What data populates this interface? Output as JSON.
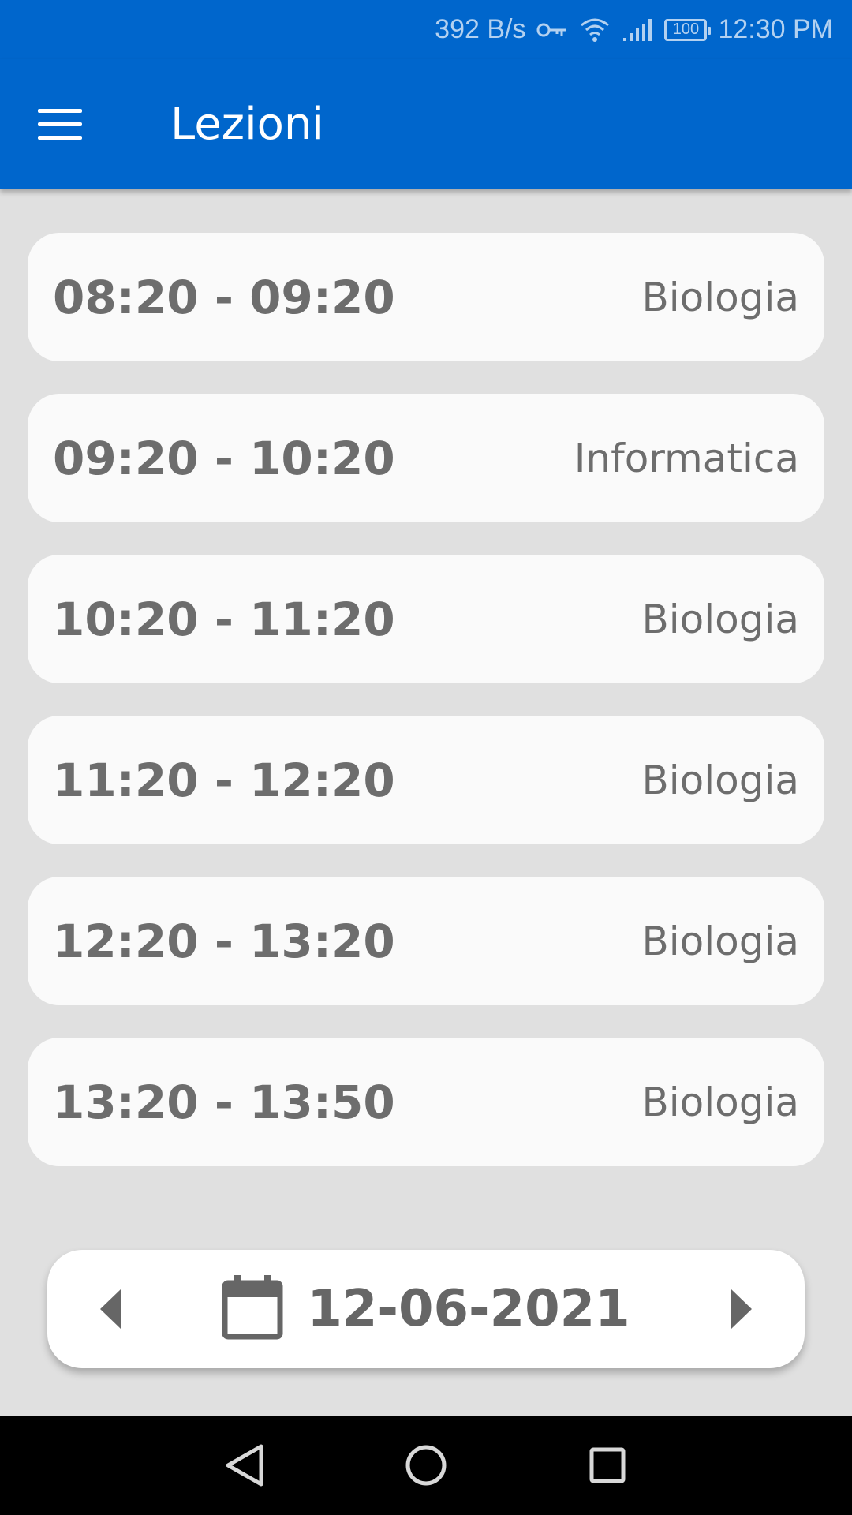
{
  "status_bar": {
    "net_speed": "392 B/s",
    "battery": "100",
    "time": "12:30 PM",
    "icons": [
      "key-icon",
      "wifi-icon",
      "signal-icon",
      "battery-icon"
    ]
  },
  "app_bar": {
    "title": "Lezioni",
    "menu_icon": "hamburger-menu-icon",
    "background": "#0066cc"
  },
  "lessons": [
    {
      "time": "08:20 - 09:20",
      "subject": "Biologia"
    },
    {
      "time": "09:20 - 10:20",
      "subject": "Informatica"
    },
    {
      "time": "10:20 - 11:20",
      "subject": "Biologia"
    },
    {
      "time": "11:20 - 12:20",
      "subject": "Biologia"
    },
    {
      "time": "12:20 - 13:20",
      "subject": "Biologia"
    },
    {
      "time": "13:20 - 13:50",
      "subject": "Biologia"
    }
  ],
  "date_selector": {
    "date": "12-06-2021",
    "icons": [
      "prev-arrow-icon",
      "calendar-icon",
      "next-arrow-icon"
    ]
  },
  "nav_bar": {
    "icons": [
      "back-icon",
      "home-icon",
      "recents-icon"
    ]
  }
}
